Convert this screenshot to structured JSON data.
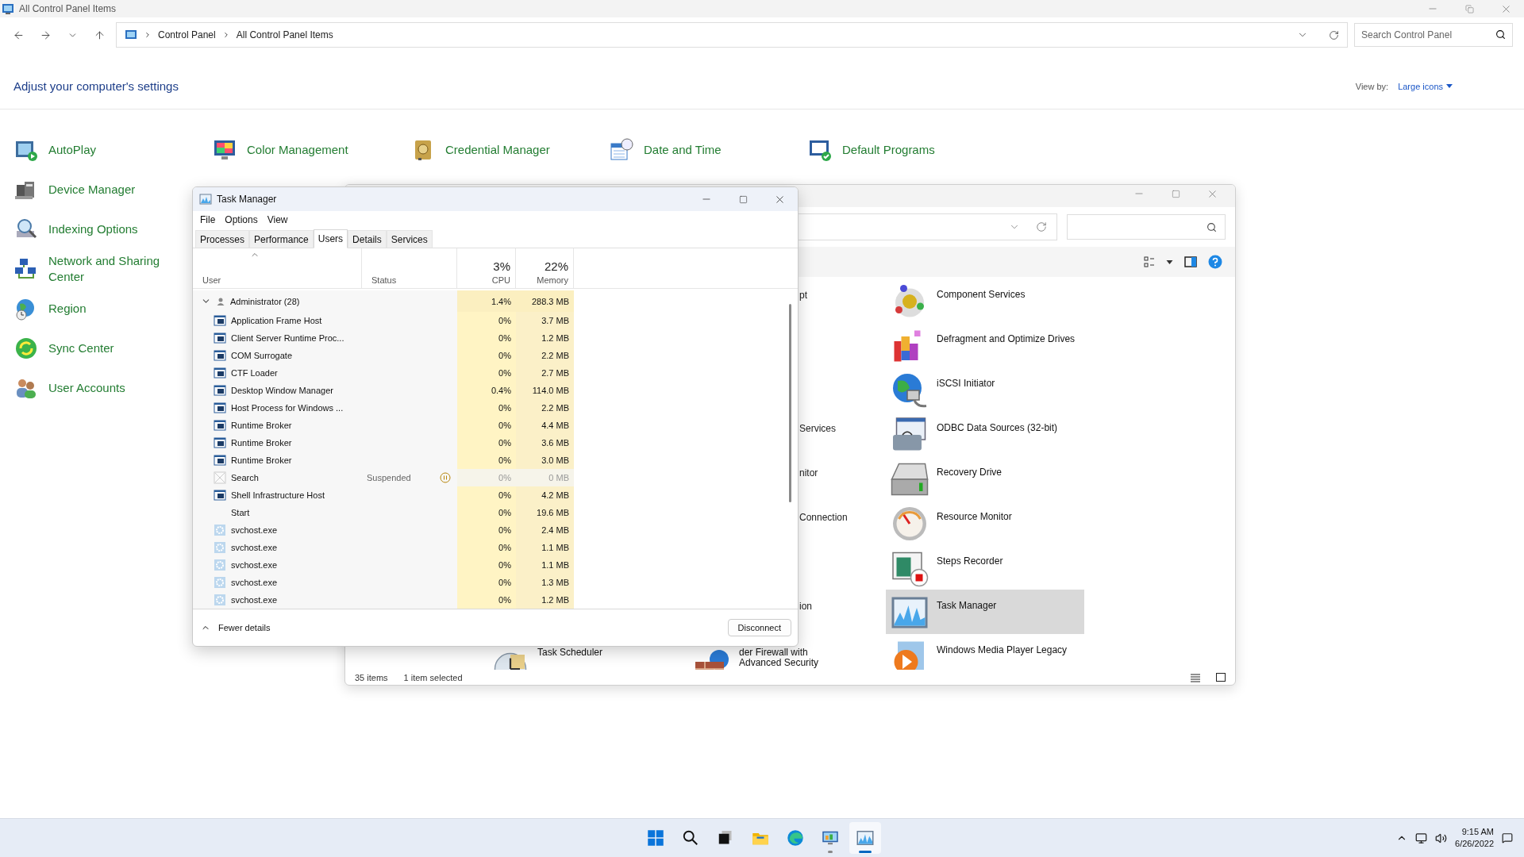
{
  "window": {
    "title": "All Control Panel Items"
  },
  "nav": {
    "breadcrumb": [
      "Control Panel",
      "All Control Panel Items"
    ],
    "search": {
      "placeholder": "Search Control Panel"
    }
  },
  "heading": "Adjust your computer's settings",
  "view_by": {
    "label": "View by:",
    "value": "Large icons"
  },
  "columns": [
    [
      {
        "label": "AutoPlay"
      },
      {
        "label": "Device Manager"
      },
      {
        "label": "Indexing Options"
      },
      {
        "label": "Network and Sharing Center"
      },
      {
        "label": "Region"
      },
      {
        "label": "Sync Center"
      },
      {
        "label": "User Accounts"
      }
    ],
    [
      {
        "label": "Color Management"
      }
    ],
    [
      {
        "label": "Credential Manager"
      }
    ],
    [
      {
        "label": "Date and Time"
      }
    ],
    [
      {
        "label": "Default Programs"
      }
    ]
  ],
  "explorer": {
    "items": [
      {
        "label": "Component Services",
        "selected": false,
        "left_fragment": "pt"
      },
      {
        "label": "Defragment and Optimize Drives",
        "selected": false
      },
      {
        "label": "iSCSI Initiator",
        "selected": false
      },
      {
        "label": "ODBC Data Sources (32-bit)",
        "selected": false,
        "left_fragment": "Services"
      },
      {
        "label": "Recovery Drive",
        "selected": false,
        "left_fragment": "nitor"
      },
      {
        "label": "Resource Monitor",
        "selected": false,
        "left_fragment": "Connection"
      },
      {
        "label": "Steps Recorder",
        "selected": false
      },
      {
        "label": "Task Manager",
        "selected": true,
        "left_fragment": "ion"
      },
      {
        "label": "Windows Media Player Legacy",
        "selected": false
      }
    ],
    "bottom_row": [
      {
        "label": "Task Scheduler"
      },
      {
        "label": "der Firewall with\nAdvanced Security"
      }
    ],
    "status": [
      "35 items",
      "1 item selected"
    ]
  },
  "task_manager": {
    "title": "Task Manager",
    "menu": [
      "File",
      "Options",
      "View"
    ],
    "tabs": [
      {
        "label": "Processes",
        "selected": false
      },
      {
        "label": "Performance",
        "selected": false
      },
      {
        "label": "Users",
        "selected": true
      },
      {
        "label": "Details",
        "selected": false
      },
      {
        "label": "Services",
        "selected": false
      }
    ],
    "headers": {
      "user": "User",
      "status": "Status",
      "cpu_total": "3%",
      "cpu": "CPU",
      "memory_total": "22%",
      "memory": "Memory"
    },
    "user_row": {
      "name": "Administrator (28)",
      "expanded": true,
      "cpu": "1.4%",
      "memory": "288.3 MB"
    },
    "processes": [
      {
        "name": "Application Frame Host",
        "kind": "app",
        "cpu": "0%",
        "memory": "3.7 MB"
      },
      {
        "name": "Client Server Runtime Proc...",
        "kind": "app",
        "cpu": "0%",
        "memory": "1.2 MB"
      },
      {
        "name": "COM Surrogate",
        "kind": "app",
        "cpu": "0%",
        "memory": "2.2 MB"
      },
      {
        "name": "CTF Loader",
        "kind": "app",
        "cpu": "0%",
        "memory": "2.7 MB"
      },
      {
        "name": "Desktop Window Manager",
        "kind": "app",
        "cpu": "0.4%",
        "memory": "114.0 MB"
      },
      {
        "name": "Host Process for Windows ...",
        "kind": "app",
        "cpu": "0%",
        "memory": "2.2 MB"
      },
      {
        "name": "Runtime Broker",
        "kind": "app",
        "cpu": "0%",
        "memory": "4.4 MB"
      },
      {
        "name": "Runtime Broker",
        "kind": "app",
        "cpu": "0%",
        "memory": "3.6 MB"
      },
      {
        "name": "Runtime Broker",
        "kind": "app",
        "cpu": "0%",
        "memory": "3.0 MB"
      },
      {
        "name": "Search",
        "kind": "suspended",
        "status": "Suspended",
        "cpu": "0%",
        "memory": "0 MB"
      },
      {
        "name": "Shell Infrastructure Host",
        "kind": "app",
        "cpu": "0%",
        "memory": "4.2 MB"
      },
      {
        "name": "Start",
        "kind": "blank",
        "cpu": "0%",
        "memory": "19.6 MB"
      },
      {
        "name": "svchost.exe",
        "kind": "service",
        "cpu": "0%",
        "memory": "2.4 MB"
      },
      {
        "name": "svchost.exe",
        "kind": "service",
        "cpu": "0%",
        "memory": "1.1 MB"
      },
      {
        "name": "svchost.exe",
        "kind": "service",
        "cpu": "0%",
        "memory": "1.1 MB"
      },
      {
        "name": "svchost.exe",
        "kind": "service",
        "cpu": "0%",
        "memory": "1.3 MB"
      },
      {
        "name": "svchost.exe",
        "kind": "service",
        "cpu": "0%",
        "memory": "1.2 MB"
      }
    ],
    "footer": {
      "toggle": "Fewer details",
      "button": "Disconnect"
    }
  },
  "taskbar": {
    "apps": [
      {
        "selected": false,
        "running": false
      },
      {
        "selected": false,
        "running": false
      },
      {
        "selected": false,
        "running": false
      },
      {
        "selected": false,
        "running": false
      },
      {
        "selected": false,
        "running": false
      },
      {
        "selected": false,
        "running": true
      },
      {
        "selected": true,
        "running": true
      }
    ],
    "time": "9:15 AM",
    "date": "6/26/2022"
  }
}
